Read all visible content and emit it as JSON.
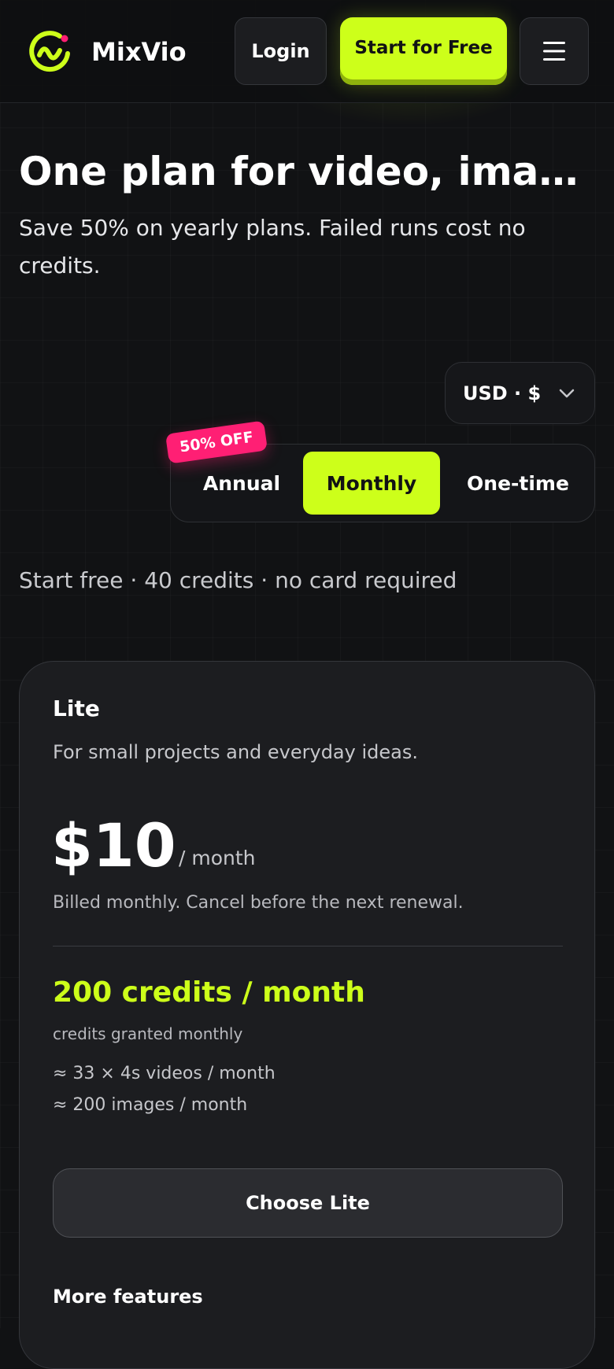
{
  "colors": {
    "accent": "#cdff1a",
    "badge": "#ff1f74",
    "background": "#111214",
    "card": "#1c1d20"
  },
  "header": {
    "brand": "MixVio",
    "logo_icon": "mixvio-logo-icon",
    "login_label": "Login",
    "start_label": "Start for Free",
    "menu_icon": "hamburger-menu-icon"
  },
  "hero": {
    "title": "One plan for video, image, ...",
    "subtitle": "Save 50% on yearly plans. Failed runs cost no credits."
  },
  "currency": {
    "selected": "USD · $",
    "icon": "chevron-down-icon"
  },
  "billing_toggle": {
    "options": [
      "Annual",
      "Monthly",
      "One-time"
    ],
    "selected": "Monthly",
    "badge": "50% OFF"
  },
  "free_note": "Start free · 40 credits · no card required",
  "plan": {
    "name": "Lite",
    "description": "For small projects and everyday ideas.",
    "price": "$10",
    "period": "/ month",
    "billing_note": "Billed monthly. Cancel before the next renewal.",
    "credits": "200 credits / month",
    "credits_note": "credits granted monthly",
    "usage": [
      "≈ 33 × 4s videos / month",
      "≈ 200 images / month"
    ],
    "cta": "Choose Lite",
    "more_features": "More features"
  }
}
